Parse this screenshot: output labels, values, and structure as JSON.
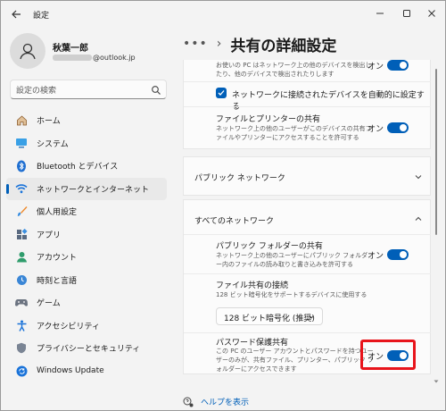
{
  "app": {
    "title": "設定"
  },
  "user": {
    "name": "秋葉一郎",
    "email_suffix": "@outlook.jp"
  },
  "search": {
    "placeholder": "設定の検索"
  },
  "nav": {
    "items": [
      {
        "label": "ホーム",
        "icon": "home-icon"
      },
      {
        "label": "システム",
        "icon": "system-icon"
      },
      {
        "label": "Bluetooth とデバイス",
        "icon": "bluetooth-icon"
      },
      {
        "label": "ネットワークとインターネット",
        "icon": "wifi-icon",
        "active": true
      },
      {
        "label": "個人用設定",
        "icon": "brush-icon"
      },
      {
        "label": "アプリ",
        "icon": "apps-icon"
      },
      {
        "label": "アカウント",
        "icon": "account-icon"
      },
      {
        "label": "時刻と言語",
        "icon": "time-language-icon"
      },
      {
        "label": "ゲーム",
        "icon": "gamepad-icon"
      },
      {
        "label": "アクセシビリティ",
        "icon": "accessibility-icon"
      },
      {
        "label": "プライバシーとセキュリティ",
        "icon": "shield-icon"
      },
      {
        "label": "Windows Update",
        "icon": "windows-update-icon"
      }
    ]
  },
  "header": {
    "crumb_dots": "•••",
    "crumb_sep": "›",
    "title": "共有の詳細設定"
  },
  "private": {
    "discovery_desc": "お使いの PC はネットワーク上の他のデバイスを検出したり、他のデバイスで検出されたりします",
    "discovery_state": "オン",
    "auto_setup_label": "ネットワークに接続されたデバイスを自動的に設定する",
    "file_printer_title": "ファイルとプリンターの共有",
    "file_printer_desc": "ネットワーク上の他のユーザーがこのデバイスの共有ファイルやプリンターにアクセスすることを許可する",
    "file_printer_state": "オン"
  },
  "public_network": {
    "title": "パブリック ネットワーク"
  },
  "all_networks": {
    "title": "すべてのネットワーク",
    "public_folder_title": "パブリック フォルダーの共有",
    "public_folder_desc": "ネットワーク上の他のユーザーにパブリック フォルダー内のファイルの読み取りと書き込みを許可する",
    "public_folder_state": "オン",
    "file_conn_title": "ファイル共有の接続",
    "file_conn_desc": "128 ビット暗号化をサポートするデバイスに使用する",
    "file_conn_value": "128 ビット暗号化 (推奨)",
    "password_title": "パスワード保護共有",
    "password_desc": "この PC のユーザー アカウントとパスワードを持つユーザーのみが、共有ファイル、プリンター、パブリック フォルダーにアクセスできます",
    "password_state": "オン"
  },
  "help": {
    "label": "ヘルプを表示"
  },
  "colors": {
    "accent": "#005fb8",
    "highlight": "#e8141b"
  }
}
